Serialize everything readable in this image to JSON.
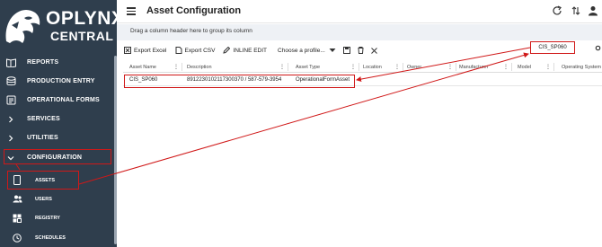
{
  "brand": {
    "title": "OPLYNX",
    "subtitle": "CENTRAL"
  },
  "sidebar": {
    "items": [
      {
        "label": "REPORTS",
        "icon": "book-icon"
      },
      {
        "label": "PRODUCTION ENTRY",
        "icon": "stack-icon"
      },
      {
        "label": "OPERATIONAL FORMS",
        "icon": "forms-icon"
      },
      {
        "label": "SERVICES",
        "icon": "chevron-right-icon"
      },
      {
        "label": "UTILITIES",
        "icon": "chevron-right-icon"
      },
      {
        "label": "CONFIGURATION",
        "icon": "chevron-down-icon"
      }
    ],
    "subitems": [
      {
        "label": "ASSETS",
        "icon": "device-icon"
      },
      {
        "label": "USERS",
        "icon": "users-icon"
      },
      {
        "label": "REGISTRY",
        "icon": "registry-icon"
      },
      {
        "label": "SCHEDULES",
        "icon": "clock-icon"
      }
    ]
  },
  "header": {
    "title": "Asset Configuration"
  },
  "group_bar": {
    "text": "Drag a column header here to group its column"
  },
  "toolbar": {
    "export_excel": "Export Excel",
    "export_csv": "Export CSV",
    "inline_edit": "INLINE EDIT",
    "profile_placeholder": "Choose a profile..."
  },
  "search": {
    "value": "CIS_SP060"
  },
  "grid": {
    "columns": [
      "Asset Name",
      "Description",
      "Asset Type",
      "Location",
      "Owner",
      "Manufacturer",
      "Model",
      "Operating System"
    ],
    "rows": [
      {
        "asset_name": "CIS_SP060",
        "description": "89122301021173003​70 / 587-579-3954",
        "asset_type": "OperationalFormAsset"
      }
    ]
  },
  "colors": {
    "sidebar": "#2f3e4d",
    "highlight": "#d01818"
  }
}
